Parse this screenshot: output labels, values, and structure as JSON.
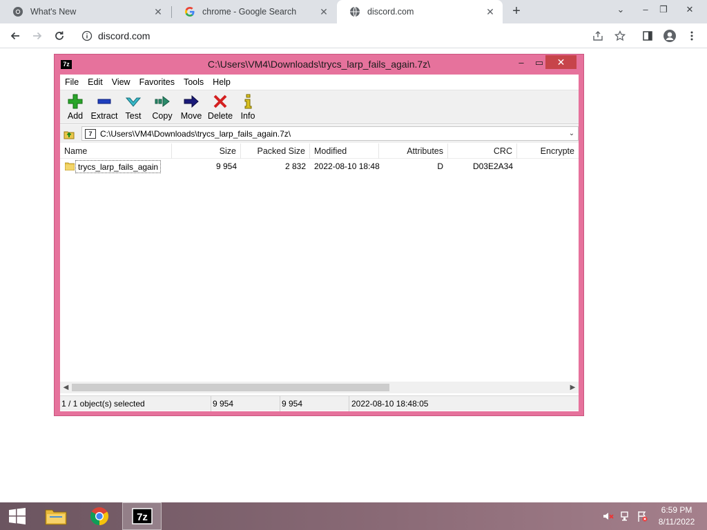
{
  "browser": {
    "tabs": [
      {
        "title": "What's New",
        "icon": "chrome-logo-icon",
        "active": false
      },
      {
        "title": "chrome - Google Search",
        "icon": "google-logo-icon",
        "active": false
      },
      {
        "title": "discord.com",
        "icon": "globe-icon",
        "active": true
      }
    ],
    "url": "discord.com"
  },
  "sevenzip": {
    "title": "C:\\Users\\VM4\\Downloads\\trycs_larp_fails_again.7z\\",
    "logo_text": "7z",
    "menu": [
      "File",
      "Edit",
      "View",
      "Favorites",
      "Tools",
      "Help"
    ],
    "toolbar": [
      {
        "label": "Add",
        "icon": "add-plus-icon",
        "color": "#2aa52a"
      },
      {
        "label": "Extract",
        "icon": "extract-minus-icon",
        "color": "#1f3fbf"
      },
      {
        "label": "Test",
        "icon": "test-check-icon",
        "color": "#38b8c8"
      },
      {
        "label": "Copy",
        "icon": "copy-arrow-icon",
        "color": "#2a8a6a"
      },
      {
        "label": "Move",
        "icon": "move-arrow-icon",
        "color": "#1a1a7a"
      },
      {
        "label": "Delete",
        "icon": "delete-x-icon",
        "color": "#d42020"
      },
      {
        "label": "Info",
        "icon": "info-icon",
        "color": "#d8c020"
      }
    ],
    "address": "C:\\Users\\VM4\\Downloads\\trycs_larp_fails_again.7z\\",
    "columns": [
      "Name",
      "Size",
      "Packed Size",
      "Modified",
      "Attributes",
      "CRC",
      "Encrypte"
    ],
    "rows": [
      {
        "name": "trycs_larp_fails_again",
        "size": "9 954",
        "packed": "2 832",
        "modified": "2022-08-10 18:48",
        "attributes": "D",
        "crc": "D03E2A34",
        "encrypted": ""
      }
    ],
    "status": {
      "selection": "1 / 1 object(s) selected",
      "size": "9 954",
      "packed": "9 954",
      "modified": "2022-08-10 18:48:05"
    }
  },
  "taskbar": {
    "time": "6:59 PM",
    "date": "8/11/2022",
    "apps": [
      "file-explorer-icon",
      "chrome-icon",
      "7zip-icon"
    ]
  }
}
